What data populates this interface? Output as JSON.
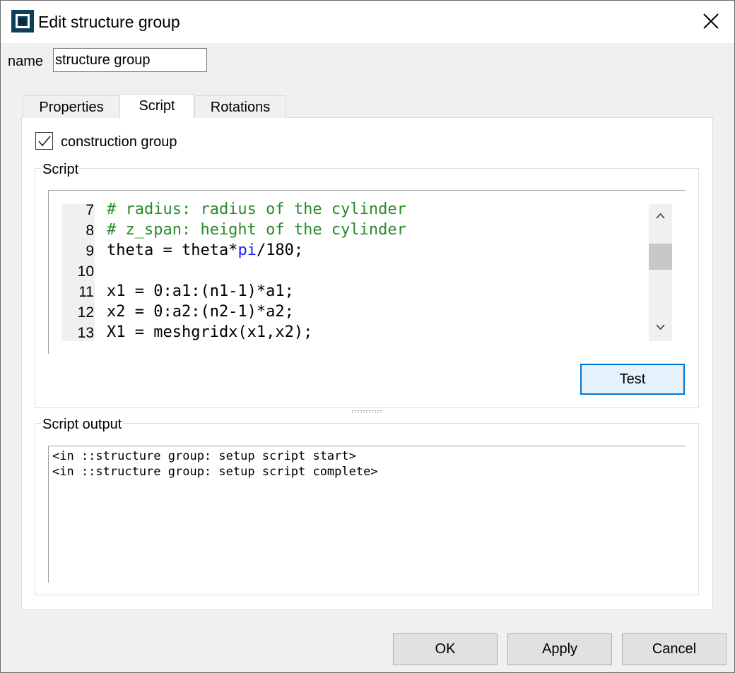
{
  "window": {
    "title": "Edit structure group"
  },
  "name_field": {
    "label": "name",
    "value": "structure group"
  },
  "tabs": [
    {
      "label": "Properties",
      "active": false
    },
    {
      "label": "Script",
      "active": true
    },
    {
      "label": "Rotations",
      "active": false
    }
  ],
  "construction_group": {
    "label": "construction group",
    "checked": true
  },
  "script_section": {
    "title": "Script",
    "lines": [
      {
        "num": "7",
        "parts": [
          {
            "text": "# radius: radius of the cylinder",
            "kind": "comment"
          }
        ]
      },
      {
        "num": "8",
        "parts": [
          {
            "text": "# z_span: height of the cylinder",
            "kind": "comment"
          }
        ]
      },
      {
        "num": "9",
        "parts": [
          {
            "text": "theta = theta*",
            "kind": "code"
          },
          {
            "text": "pi",
            "kind": "builtin"
          },
          {
            "text": "/180;",
            "kind": "code"
          }
        ]
      },
      {
        "num": "10",
        "parts": []
      },
      {
        "num": "11",
        "parts": [
          {
            "text": "x1 = 0:a1:(n1-1)*a1;",
            "kind": "code"
          }
        ]
      },
      {
        "num": "12",
        "parts": [
          {
            "text": "x2 = 0:a2:(n2-1)*a2;",
            "kind": "code"
          }
        ]
      },
      {
        "num": "13",
        "parts": [
          {
            "text": "X1 = meshgridx(x1,x2);",
            "kind": "code"
          }
        ]
      }
    ],
    "test_label": "Test"
  },
  "output_section": {
    "title": "Script output",
    "lines": [
      "<in ::structure group: setup script start>",
      "<in ::structure group: setup script complete>"
    ]
  },
  "buttons": {
    "ok": "OK",
    "apply": "Apply",
    "cancel": "Cancel"
  },
  "colors": {
    "comment": "#2a8a2a",
    "builtin": "#1a1aff",
    "focus_border": "#0078d7"
  }
}
